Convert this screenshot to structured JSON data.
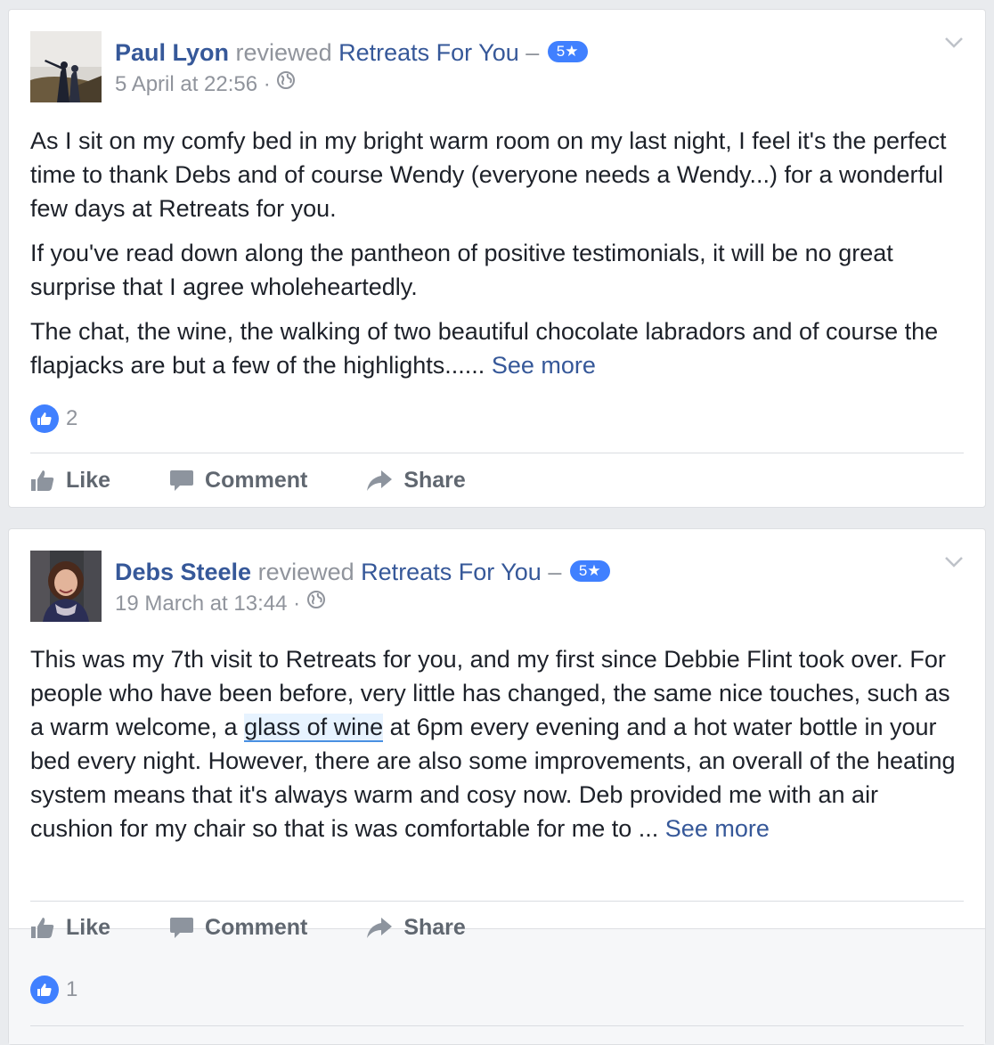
{
  "posts": [
    {
      "author": "Paul Lyon",
      "verb": "reviewed",
      "page": "Retreats For You",
      "dash": "–",
      "rating": "5★",
      "timestamp": "5 April at 22:56",
      "separator": "·",
      "paragraphs": [
        "As I sit on my comfy bed in my bright warm room on my last night, I feel it's the perfect time to thank Debs and of course Wendy (everyone needs a Wendy...) for a wonderful few days at Retreats for you.",
        "If you've read down along the pantheon of positive testimonials, it will be no great surprise that I agree wholeheartedly.",
        "The chat, the wine, the walking of two beautiful chocolate labradors and of course the flapjacks are but a few of the highlights......"
      ],
      "see_more": "See more",
      "likes": "2",
      "actions": {
        "like": "Like",
        "comment": "Comment",
        "share": "Share"
      }
    },
    {
      "author": "Debs Steele",
      "verb": "reviewed",
      "page": "Retreats For You",
      "dash": "–",
      "rating": "5★",
      "timestamp": "19 March at 13:44",
      "separator": "·",
      "text_before": "This was my 7th visit to Retreats for you, and my first since Debbie Flint took over. For people who have been before, very little has changed, the same nice touches, such as a warm welcome, a ",
      "text_highlight": "glass of wine",
      "text_after": " at 6pm every evening and a hot water bottle in your bed every night. However, there are also some improvements, an overall of the heating system means that it's always warm and cosy now. Deb provided me with an air cushion for my chair so that is was comfortable for me to ...",
      "see_more": "See more",
      "likes": "1",
      "actions": {
        "like": "Like",
        "comment": "Comment",
        "share": "Share"
      }
    }
  ],
  "colors": {
    "link": "#365899",
    "meta": "#90949c",
    "accent": "#4080ff",
    "background": "#e9ebee"
  }
}
